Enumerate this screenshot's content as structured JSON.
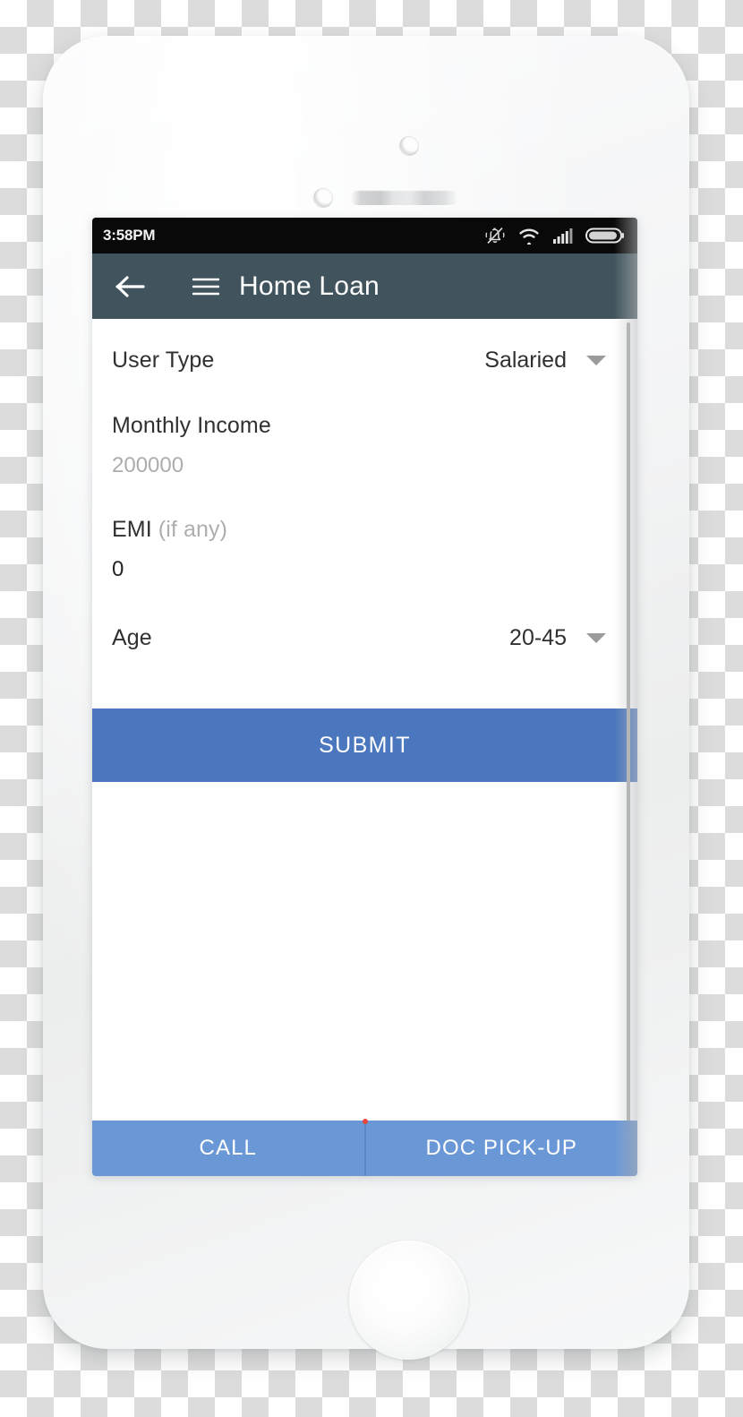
{
  "status_bar": {
    "time": "3:58PM",
    "icons": [
      "bell-off-icon",
      "wifi-icon",
      "signal-bars-icon",
      "battery-icon"
    ]
  },
  "app_bar": {
    "back_icon": "back-arrow-icon",
    "menu_icon": "hamburger-menu-icon",
    "title": "Home Loan"
  },
  "form": {
    "fields": [
      {
        "type": "select",
        "label": "User Type",
        "value": "Salaried",
        "caret_icon": "chevron-down-icon"
      },
      {
        "type": "text",
        "label": "Monthly Income",
        "value": "200000",
        "value_state": "placeholder"
      },
      {
        "type": "text",
        "label": "EMI",
        "label_suffix": "(if any)",
        "value": "0",
        "value_state": "filled"
      },
      {
        "type": "select",
        "label": "Age",
        "value": "20-45",
        "caret_icon": "chevron-down-icon"
      }
    ]
  },
  "submit": {
    "label": "SUBMIT"
  },
  "bottom_bar": {
    "call_label": "CALL",
    "doc_label": "DOC PICK-UP"
  },
  "colors": {
    "app_bar": "#41545d",
    "status_bar": "#090909",
    "submit_blue": "#4a77bd",
    "bottom_blue": "#6a97d6",
    "divider_dot_red": "#e8453c",
    "label_text": "#303030",
    "muted_text": "#aeaeae"
  }
}
